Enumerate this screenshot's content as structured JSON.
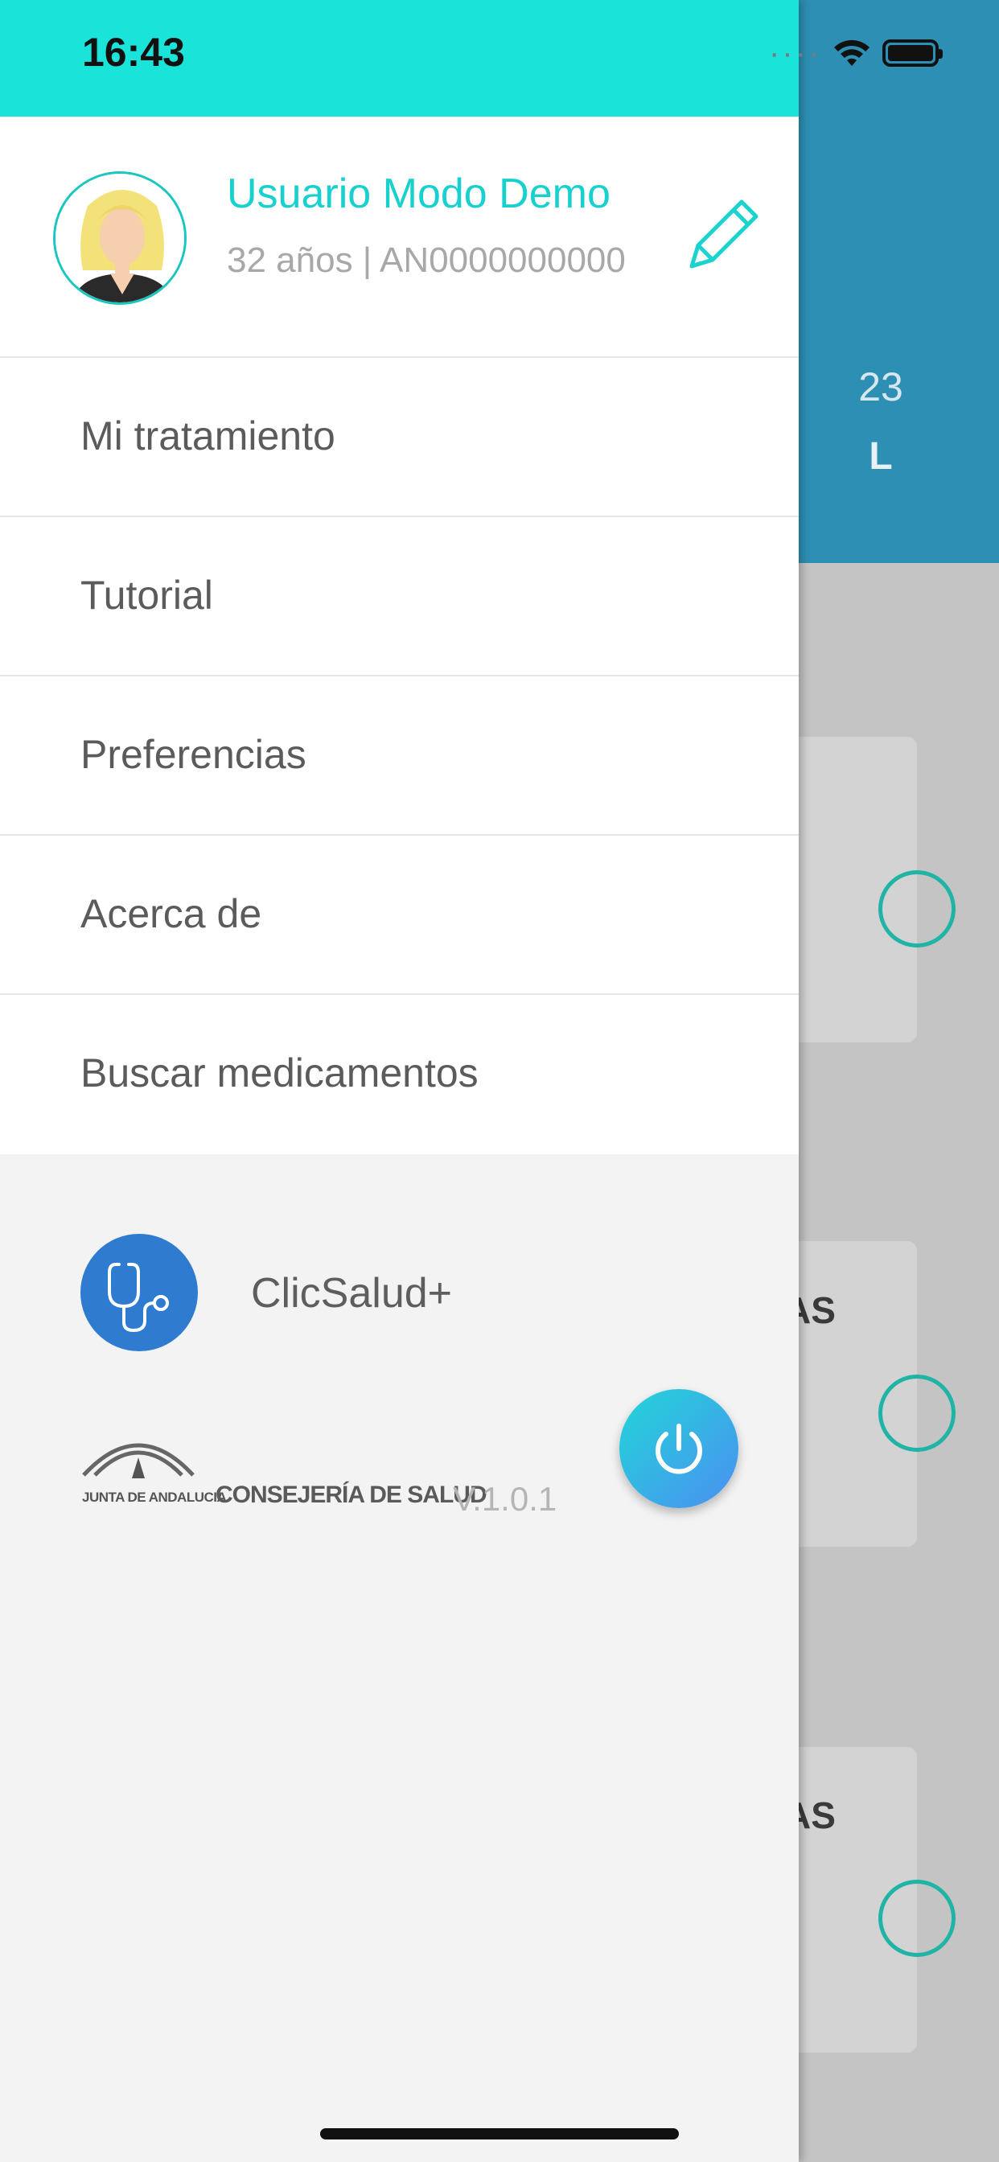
{
  "status_bar": {
    "time": "16:43"
  },
  "profile": {
    "name": "Usuario Modo Demo",
    "subtitle": "32 años | AN0000000000"
  },
  "menu": [
    {
      "label": "Mi tratamiento"
    },
    {
      "label": "Tutorial"
    },
    {
      "label": "Preferencias"
    },
    {
      "label": "Acerca de"
    },
    {
      "label": "Buscar medicamentos"
    }
  ],
  "clicsalud": {
    "label": "ClicSalud+"
  },
  "footer": {
    "junta_text": "JUNTA DE ANDALUCIA",
    "consejeria": "CONSEJERÍA DE SALUD",
    "version": "V.1.0.1"
  },
  "background_app": {
    "date_number": "23",
    "day_letter": "L",
    "card_labels": [
      "AS",
      "AS"
    ]
  },
  "colors": {
    "accent": "#1ae3d9",
    "header_bg": "#2d8fb4",
    "clicsalud": "#2f7bd0"
  }
}
